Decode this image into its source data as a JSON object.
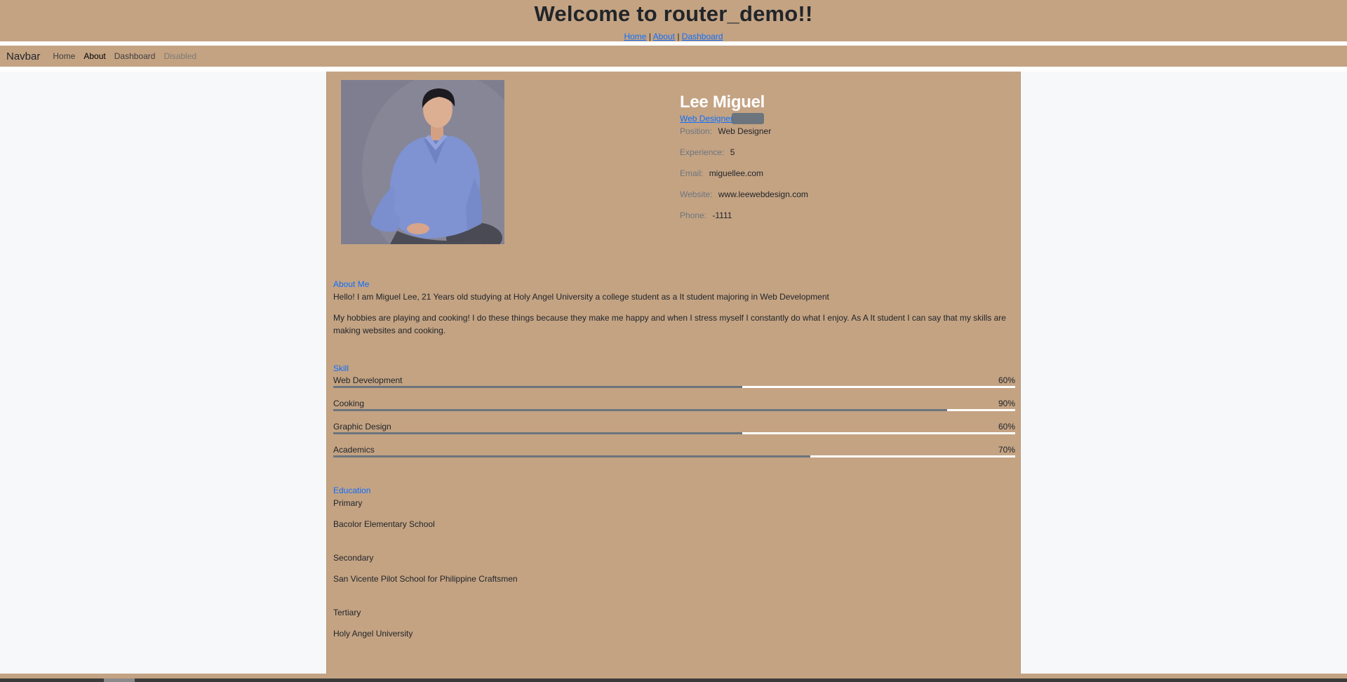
{
  "header": {
    "title": "Welcome to router_demo!!",
    "links": [
      {
        "label": "Home"
      },
      {
        "label": "About"
      },
      {
        "label": "Dashboard"
      }
    ],
    "separator": "|"
  },
  "navbar": {
    "brand": "Navbar",
    "items": [
      {
        "label": "Home",
        "state": "normal"
      },
      {
        "label": "About",
        "state": "active"
      },
      {
        "label": "Dashboard",
        "state": "normal"
      },
      {
        "label": "Disabled",
        "state": "disabled"
      }
    ]
  },
  "profile": {
    "name": "Lee Miguel",
    "role_link": "Web Designer",
    "photo_icon": "profile-photo",
    "fields": [
      {
        "label": "Position:",
        "value": "Web Designer"
      },
      {
        "label": "Experience:",
        "value": "5"
      },
      {
        "label": "Email:",
        "value": "miguellee.com"
      },
      {
        "label": "Website:",
        "value": "www.leewebdesign.com"
      },
      {
        "label": "Phone:",
        "value": "-1111"
      }
    ]
  },
  "about": {
    "title": "About Me",
    "paragraphs": [
      "Hello! I am Miguel Lee, 21 Years old studying at Holy Angel University a college student as a It student majoring in Web Development",
      "My hobbies are playing and cooking! I do these things because they make me happy and when I stress myself I constantly do what I enjoy. As A It student I can say that my skills are making websites and cooking."
    ]
  },
  "skills": {
    "title": "Skill",
    "items": [
      {
        "name": "Web Development",
        "percent_label": "60%",
        "percent": 60
      },
      {
        "name": "Cooking",
        "percent_label": "90%",
        "percent": 90
      },
      {
        "name": "Graphic Design",
        "percent_label": "60%",
        "percent": 60
      },
      {
        "name": "Academics",
        "percent_label": "70%",
        "percent": 70
      }
    ]
  },
  "education": {
    "title": "Education",
    "entries": [
      {
        "level": "Primary",
        "school": "Bacolor Elementary School"
      },
      {
        "level": "Secondary",
        "school": "San Vicente Pilot School for Philippine Craftsmen"
      },
      {
        "level": "Tertiary",
        "school": "Holy Angel University"
      }
    ]
  },
  "colors": {
    "accent": "#c4a383",
    "link": "#0d6efd",
    "muted": "#6c757d",
    "page_bg": "#f7f8fa"
  }
}
